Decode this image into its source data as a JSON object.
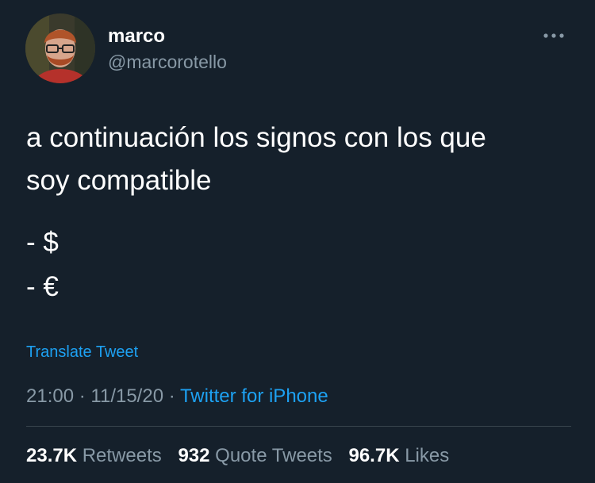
{
  "author": {
    "display_name": "marco",
    "handle": "@marcorotello"
  },
  "tweet": {
    "text_lines": [
      "a continuación los signos con los que",
      "soy compatible"
    ],
    "list_items": [
      "- $",
      "- €"
    ],
    "translate_label": "Translate Tweet",
    "time": "21:00",
    "date": "11/15/20",
    "separator": "·",
    "source": "Twitter for iPhone"
  },
  "stats": {
    "retweets_count": "23.7K",
    "retweets_label": "Retweets",
    "quote_count": "932",
    "quote_label": "Quote Tweets",
    "likes_count": "96.7K",
    "likes_label": "Likes"
  },
  "icons": {
    "more": "more-options-icon"
  },
  "colors": {
    "background": "#15202b",
    "text_primary": "#ffffff",
    "text_secondary": "#8899a6",
    "accent": "#1da1f2",
    "divider": "#38444d"
  }
}
